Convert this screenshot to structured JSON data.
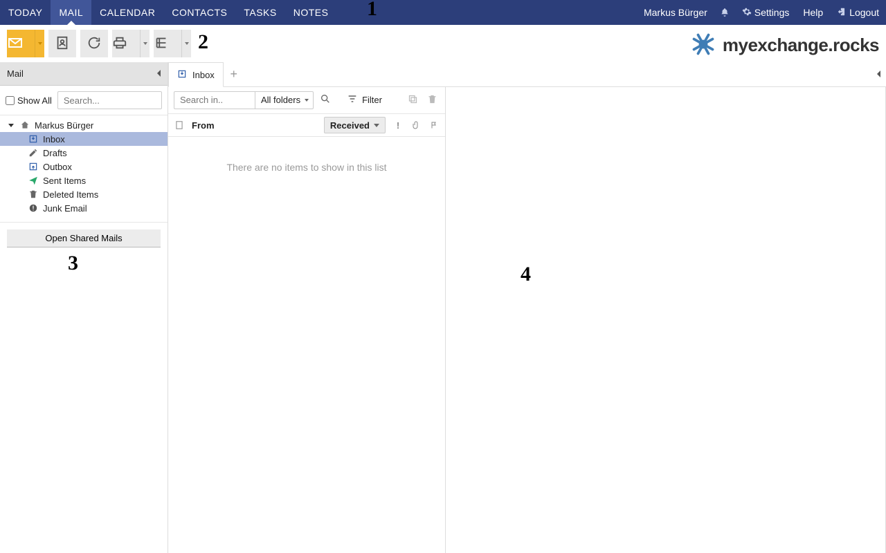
{
  "topnav": {
    "items": [
      "TODAY",
      "MAIL",
      "CALENDAR",
      "CONTACTS",
      "TASKS",
      "NOTES"
    ],
    "active_index": 1,
    "user": "Markus Bürger",
    "settings": "Settings",
    "help": "Help",
    "logout": "Logout"
  },
  "brand": "myexchange.rocks",
  "sidebar": {
    "title": "Mail",
    "show_all": "Show All",
    "search_placeholder": "Search...",
    "account": "Markus Bürger",
    "folders": [
      {
        "label": "Inbox",
        "icon": "inbox-icon",
        "selected": true
      },
      {
        "label": "Drafts",
        "icon": "pencil-icon",
        "selected": false
      },
      {
        "label": "Outbox",
        "icon": "outbox-icon",
        "selected": false
      },
      {
        "label": "Sent Items",
        "icon": "sent-icon",
        "selected": false
      },
      {
        "label": "Deleted Items",
        "icon": "trash-icon",
        "selected": false
      },
      {
        "label": "Junk Email",
        "icon": "junk-icon",
        "selected": false
      }
    ],
    "open_shared": "Open Shared Mails"
  },
  "tabs": {
    "items": [
      {
        "label": "Inbox"
      }
    ]
  },
  "list": {
    "search_in_placeholder": "Search in..",
    "folder_scope": "All folders",
    "filter": "Filter",
    "col_from": "From",
    "sort_by": "Received",
    "empty": "There are no items to show in this list"
  },
  "annotations": {
    "one": "1",
    "two": "2",
    "three": "3",
    "four": "4"
  }
}
